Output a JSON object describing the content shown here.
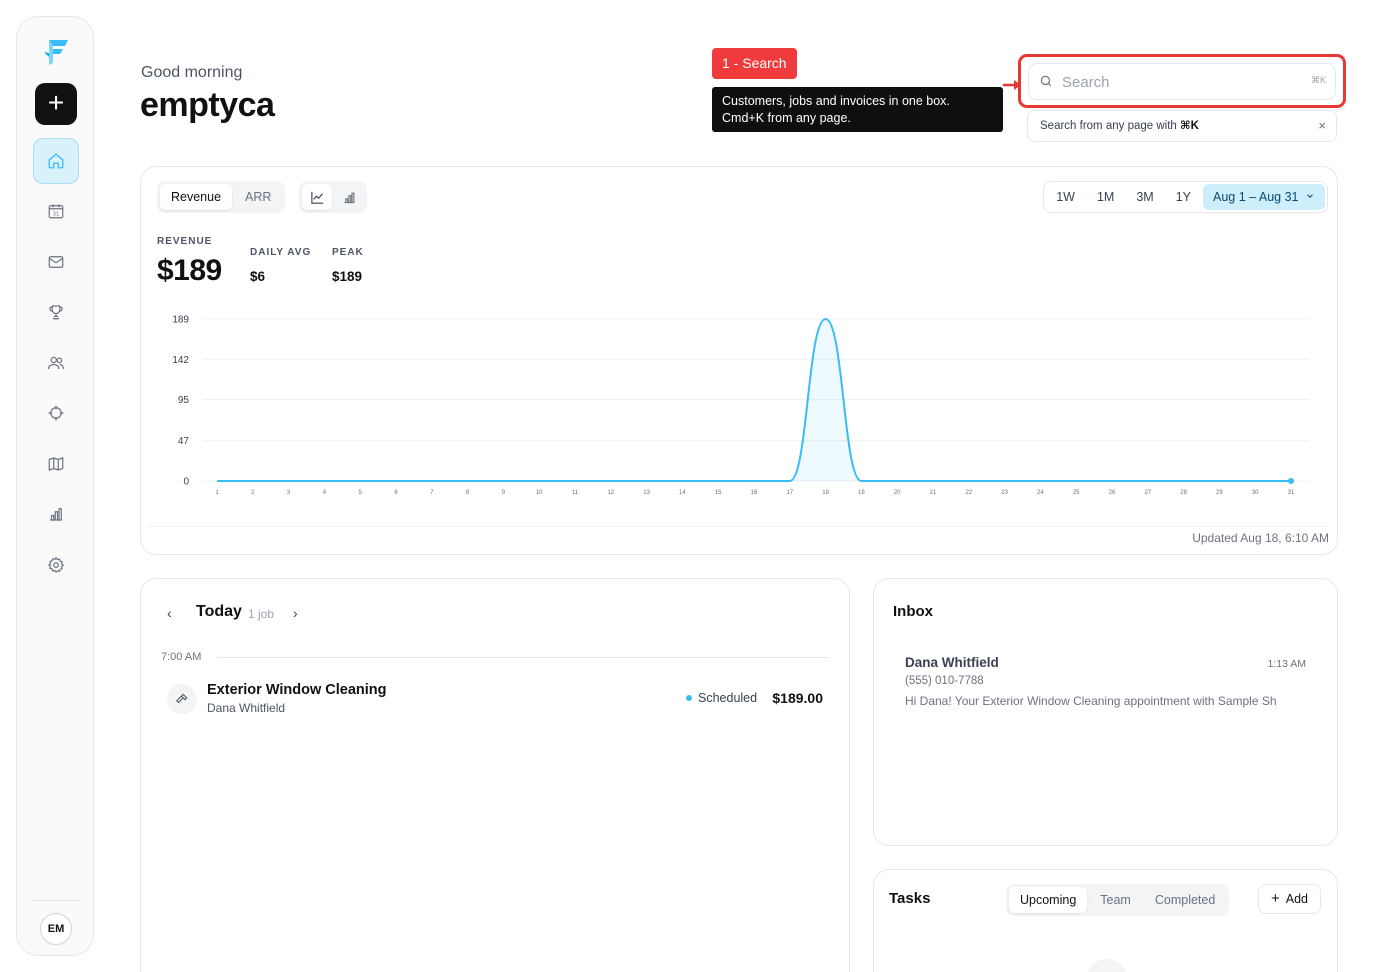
{
  "header": {
    "greeting": "Good morning",
    "company": "emptyca"
  },
  "sidebar": {
    "new_button": "+",
    "items": [
      {
        "icon": "home-icon",
        "active": true
      },
      {
        "icon": "calendar-icon",
        "active": false
      },
      {
        "icon": "mail-icon",
        "active": false
      },
      {
        "icon": "trophy-icon",
        "active": false
      },
      {
        "icon": "users-icon",
        "active": false
      },
      {
        "icon": "target-icon",
        "active": false
      },
      {
        "icon": "map-icon",
        "active": false
      },
      {
        "icon": "bar-chart-icon",
        "active": false
      },
      {
        "icon": "gear-icon",
        "active": false
      }
    ],
    "avatar": "EM"
  },
  "annotation": {
    "badge": "1 - Search",
    "tooltip_line1": "Customers, jobs and invoices in one box.",
    "tooltip_line2": "Cmd+K from any page."
  },
  "search": {
    "placeholder": "Search",
    "shortcut": "⌘K",
    "hint_prefix": "Search from any page with ",
    "hint_key": "⌘K",
    "hint_close": "×"
  },
  "revenue": {
    "metric_tabs": [
      "Revenue",
      "ARR"
    ],
    "range_tabs": [
      "1W",
      "1M",
      "3M",
      "1Y"
    ],
    "date_range": "Aug 1 – Aug 31",
    "stat_label": "REVENUE",
    "stat_value": "$189",
    "daily_avg_label": "DAILY AVG",
    "daily_avg_value": "$6",
    "peak_label": "PEAK",
    "peak_value": "$189",
    "updated": "Updated Aug 18, 6:10 AM"
  },
  "chart_data": {
    "type": "line",
    "title": "",
    "xlabel": "",
    "ylabel": "",
    "x": [
      1,
      2,
      3,
      4,
      5,
      6,
      7,
      8,
      9,
      10,
      11,
      12,
      13,
      14,
      15,
      16,
      17,
      18,
      19,
      20,
      21,
      22,
      23,
      24,
      25,
      26,
      27,
      28,
      29,
      30,
      31
    ],
    "y_ticks": [
      0,
      47,
      95,
      142,
      189
    ],
    "ylim": [
      0,
      189
    ],
    "series": [
      {
        "values": [
          0,
          0,
          0,
          0,
          0,
          0,
          0,
          0,
          0,
          0,
          0,
          0,
          0,
          0,
          0,
          0,
          0,
          189,
          0,
          0,
          0,
          0,
          0,
          0,
          0,
          0,
          0,
          0,
          0,
          0,
          0
        ],
        "color": "#38bdf8"
      }
    ],
    "grid": true,
    "legend": "none"
  },
  "today": {
    "title": "Today",
    "count": "1 job",
    "prev": "‹",
    "next": "›",
    "time": "7:00 AM",
    "job_title": "Exterior Window Cleaning",
    "job_customer": "Dana Whitfield",
    "job_status": "Scheduled",
    "job_price": "$189.00"
  },
  "inbox": {
    "title": "Inbox",
    "message": {
      "name": "Dana Whitfield",
      "time": "1:13 AM",
      "phone": "(555) 010-7788",
      "preview": "Hi Dana! Your Exterior Window Cleaning appointment with Sample Sh"
    }
  },
  "tasks": {
    "title": "Tasks",
    "tabs": [
      "Upcoming",
      "Team",
      "Completed"
    ],
    "add": "Add"
  },
  "colors": {
    "accent": "#38bdf8",
    "annotation": "#ef3b3b"
  }
}
